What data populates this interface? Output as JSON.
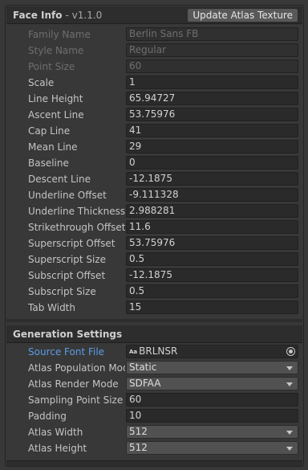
{
  "face_info": {
    "title": "Face Info",
    "version": "- v1.1.0",
    "update_button": "Update Atlas Texture",
    "rows": [
      {
        "label": "Family Name",
        "value": "Berlin Sans FB"
      },
      {
        "label": "Style Name",
        "value": "Regular"
      },
      {
        "label": "Point Size",
        "value": "60"
      },
      {
        "label": "Scale",
        "value": "1"
      },
      {
        "label": "Line Height",
        "value": "65.94727"
      },
      {
        "label": "Ascent Line",
        "value": "53.75976"
      },
      {
        "label": "Cap Line",
        "value": "41"
      },
      {
        "label": "Mean Line",
        "value": "29"
      },
      {
        "label": "Baseline",
        "value": "0"
      },
      {
        "label": "Descent Line",
        "value": "-12.1875"
      },
      {
        "label": "Underline Offset",
        "value": "-9.111328"
      },
      {
        "label": "Underline Thickness",
        "value": "2.988281"
      },
      {
        "label": "Strikethrough Offset",
        "value": "11.6"
      },
      {
        "label": "Superscript Offset",
        "value": "53.75976"
      },
      {
        "label": "Superscript Size",
        "value": "0.5"
      },
      {
        "label": "Subscript Offset",
        "value": "-12.1875"
      },
      {
        "label": "Subscript Size",
        "value": "0.5"
      },
      {
        "label": "Tab Width",
        "value": "15"
      }
    ]
  },
  "generation_settings": {
    "title": "Generation Settings",
    "source_font_file": {
      "label": "Source Font File",
      "icon": "Aa",
      "value": "BRLNSR"
    },
    "atlas_population_mode": {
      "label": "Atlas Population Mod",
      "value": "Static"
    },
    "atlas_render_mode": {
      "label": "Atlas Render Mode",
      "value": "SDFAA"
    },
    "sampling_point_size": {
      "label": "Sampling Point Size",
      "value": "60"
    },
    "padding": {
      "label": "Padding",
      "value": "10"
    },
    "atlas_width": {
      "label": "Atlas Width",
      "value": "512"
    },
    "atlas_height": {
      "label": "Atlas Height",
      "value": "512"
    }
  },
  "colors": {
    "background": "#383838",
    "header": "#2d2d2d",
    "field": "#2a2a2a",
    "dropdown": "#515151",
    "link_label": "#5c9ce6"
  }
}
